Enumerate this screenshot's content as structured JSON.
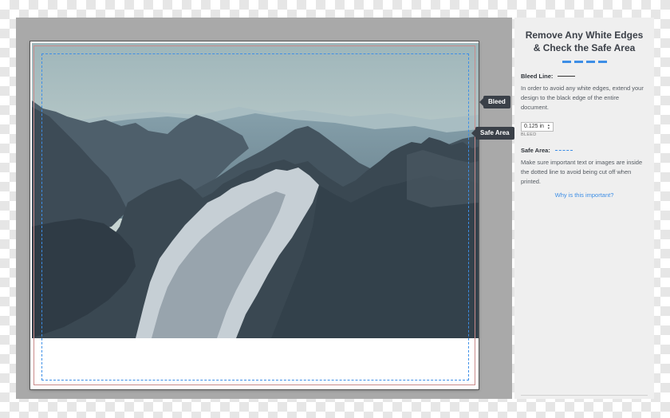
{
  "canvas": {
    "tags": {
      "bleed": "Bleed",
      "safe_area": "Safe Area"
    },
    "photo": {
      "subject": "mountain range landscape"
    }
  },
  "panel": {
    "title": "Remove Any White Edges & Check the Safe Area",
    "bleed_section": {
      "heading": "Bleed Line:",
      "description": "In order to avoid any white edges, extend your design to the black edge of the entire document.",
      "input_value": "0.125 in",
      "input_caption": "BLEED"
    },
    "safe_section": {
      "heading": "Safe Area:",
      "description": "Make sure important text or images are inside the dotted line to avoid being cut off when printed."
    },
    "help_link": "Why is this important?"
  },
  "colors": {
    "accent": "#3d8ee6",
    "workspace": "#a9a9a9",
    "panel": "#efefef",
    "tag_bg": "#3a4048",
    "bleed_line": "#c98b8b"
  },
  "icons": [
    "stepper-up-icon",
    "stepper-down-icon"
  ]
}
